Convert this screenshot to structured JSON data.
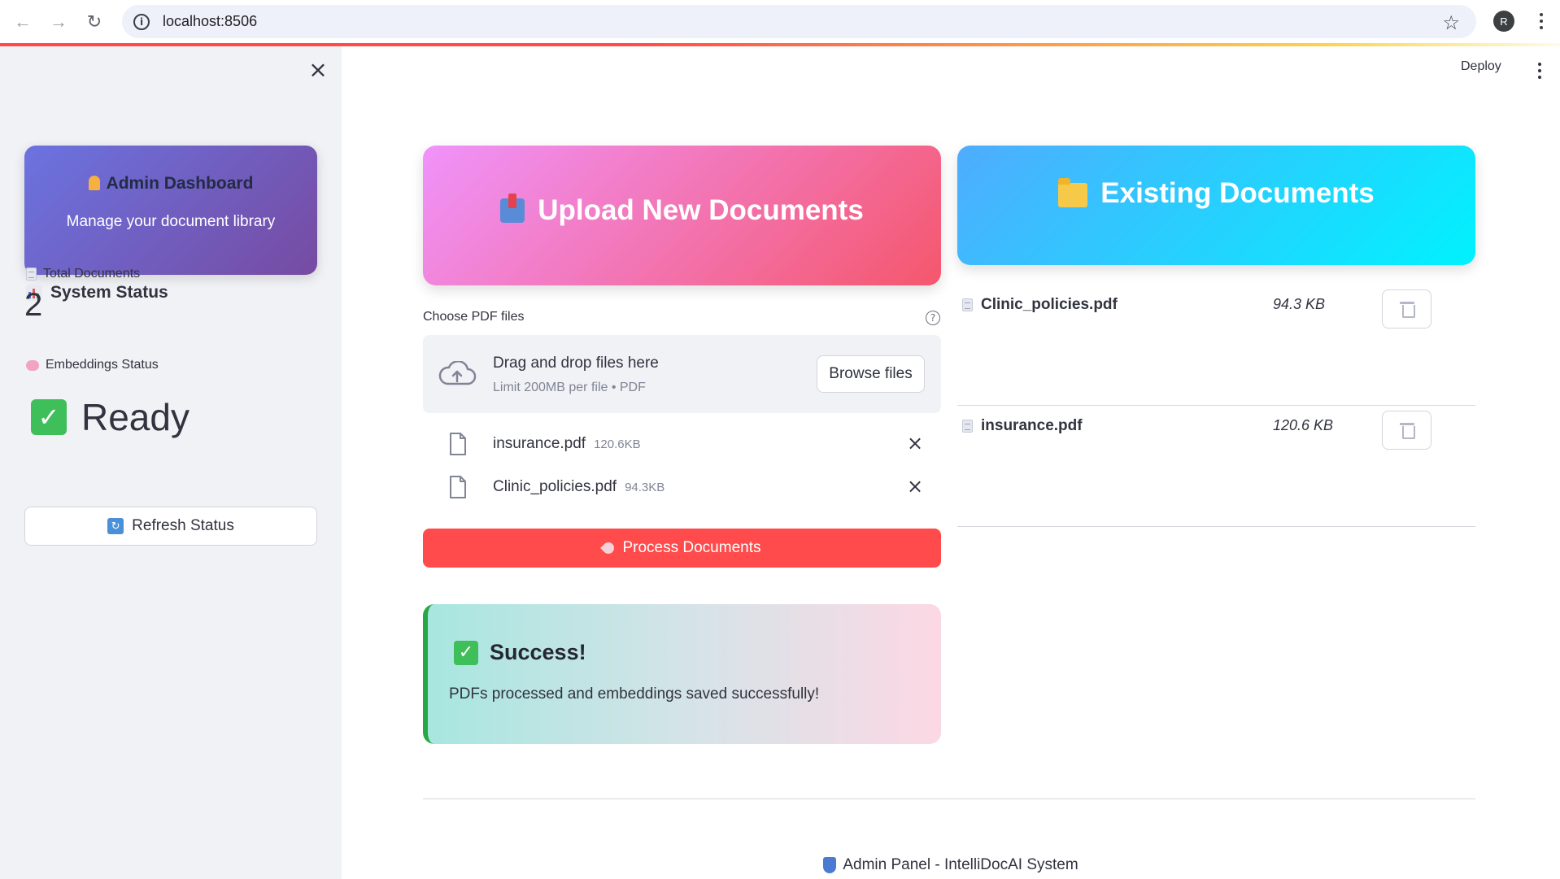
{
  "browser": {
    "url": "localhost:8506",
    "profile_initial": "R"
  },
  "header": {
    "deploy_label": "Deploy"
  },
  "sidebar": {
    "admin_title": "Admin Dashboard",
    "admin_subtitle": "Manage your document library",
    "system_status_title": "System Status",
    "total_documents_label": "Total Documents",
    "total_documents_value": "2",
    "embeddings_label": "Embeddings Status",
    "embeddings_value": "Ready",
    "refresh_label": "Refresh Status"
  },
  "upload": {
    "banner_title": "Upload New Documents",
    "choose_label": "Choose PDF files",
    "dropzone_main": "Drag and drop files here",
    "dropzone_sub": "Limit 200MB per file • PDF",
    "browse_label": "Browse files",
    "files": [
      {
        "name": "insurance.pdf",
        "size": "120.6KB"
      },
      {
        "name": "Clinic_policies.pdf",
        "size": "94.3KB"
      }
    ],
    "process_label": "Process Documents"
  },
  "success": {
    "title": "Success!",
    "message": "PDFs processed and embeddings saved successfully!"
  },
  "existing": {
    "banner_title": "Existing Documents",
    "documents": [
      {
        "name": "Clinic_policies.pdf",
        "size": "94.3 KB"
      },
      {
        "name": "insurance.pdf",
        "size": "120.6 KB"
      }
    ]
  },
  "footer": {
    "text": "Admin Panel - IntelliDocAI System"
  },
  "colors": {
    "primary": "#ff4b4b",
    "upload_gradient": [
      "#f093fb",
      "#f5576c"
    ],
    "existing_gradient": [
      "#4facfe",
      "#00f2fe"
    ],
    "admin_gradient": [
      "#667eea",
      "#764ba2"
    ],
    "success_border": "#28a745"
  },
  "icons": {
    "admin_card": "person-icon",
    "system_status": "bar-chart-icon",
    "total_documents": "document-icon",
    "embeddings": "brain-icon",
    "ready": "check-icon",
    "refresh": "refresh-icon",
    "upload_banner": "inbox-tray-icon",
    "existing_banner": "folder-icon",
    "process": "rocket-icon",
    "success": "check-icon",
    "delete": "trash-icon",
    "footer": "shield-icon"
  }
}
